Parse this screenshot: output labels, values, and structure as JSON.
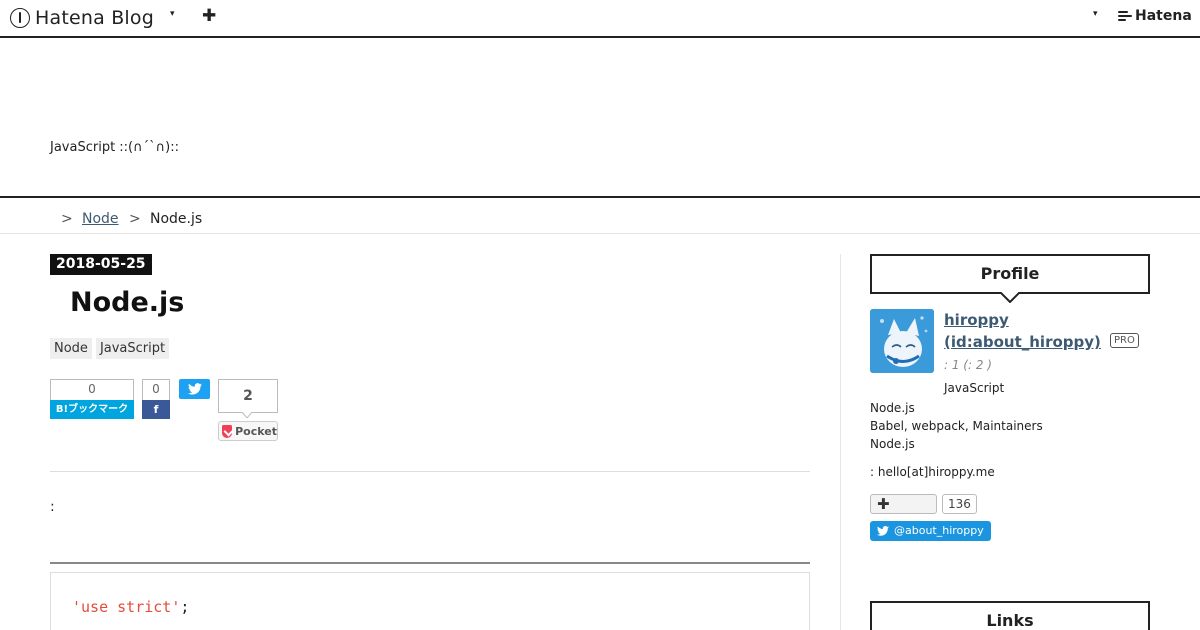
{
  "navbar": {
    "logo_text": "Hatena Blog",
    "caret": "▾",
    "add": "✚",
    "right_caret": "▾",
    "hatena_text": "Hatena"
  },
  "header": {
    "description": "JavaScript ::(∩´`∩)::"
  },
  "breadcrumb": {
    "home": " ",
    "separator": ">",
    "category": "Node ",
    "current": "Node.js"
  },
  "entry": {
    "date": "2018-05-25",
    "title": "Node.js",
    "tags": [
      "Node",
      "JavaScript"
    ],
    "intro": ":",
    "code_string": "'use strict'",
    "code_punct": ";"
  },
  "share": {
    "hatena_count": "0",
    "hatena_label": "B!ブックマーク",
    "facebook_count": "0",
    "facebook_label": "f",
    "pocket_count": "2",
    "pocket_label": "Pocket"
  },
  "sidebar": {
    "profile_heading": "Profile",
    "profile_name": "hiroppy (id:about_hiroppy)",
    "pro_badge": "PRO",
    "profile_stats": ":        1 (:        2 )",
    "profile_topic": "JavaScript",
    "bio_lines": [
      "Node.js",
      "Babel, webpack, Maintainers",
      "Node.js"
    ],
    "email": ": hello[at]hiroppy.me",
    "reader_plus": "✚",
    "reader_count": "136",
    "twitter_follow": "@about_hiroppy",
    "links_heading": "Links"
  },
  "colors": {
    "link": "#3d5a73",
    "hatena_bookmark": "#00a4de",
    "facebook": "#3b5998",
    "twitter": "#1da1f2",
    "pocket": "#ef4056",
    "code_string": "#e54c3c"
  }
}
